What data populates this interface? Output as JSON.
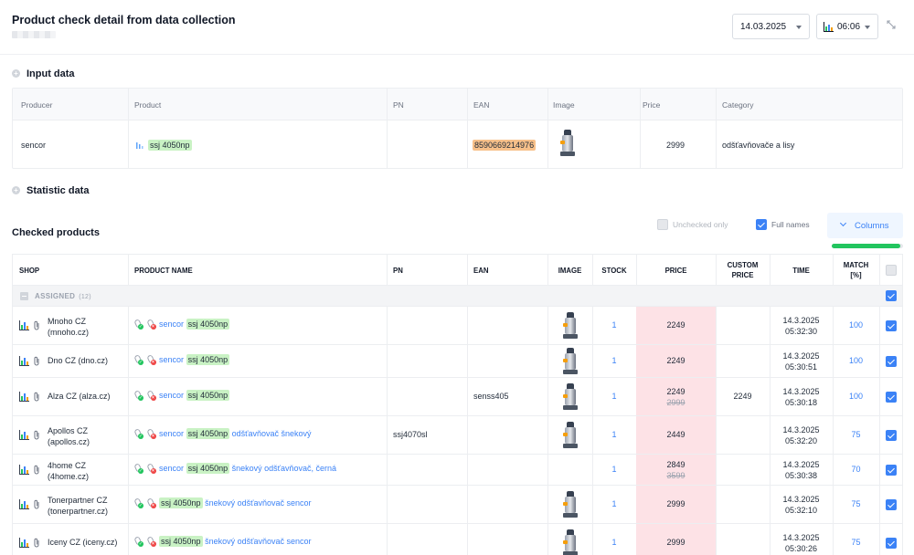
{
  "header": {
    "title": "Product check detail from data collection",
    "date": "14.03.2025",
    "time": "06:06"
  },
  "input_data": {
    "title": "Input data",
    "columns": [
      "Producer",
      "Product",
      "PN",
      "EAN",
      "Image",
      "Price",
      "Category"
    ],
    "row": {
      "producer": "sencor",
      "product": "ssj 4050np",
      "pn": "",
      "ean": "8590669214976",
      "price": "2999",
      "category": "odšťavňovače a lisy"
    }
  },
  "statistic_data": {
    "title": "Statistic data"
  },
  "checked": {
    "title": "Checked products",
    "unchecked_only_label": "Unchecked only",
    "unchecked_only": false,
    "full_names_label": "Full names",
    "full_names": true,
    "columns_button": "Columns",
    "progress": 0.96,
    "headers": {
      "shop": "SHOP",
      "product_name": "PRODUCT NAME",
      "pn": "PN",
      "ean": "EAN",
      "image": "IMAGE",
      "stock": "STOCK",
      "price": "PRICE",
      "custom_price_1": "CUSTOM",
      "custom_price_2": "PRICE",
      "time": "TIME",
      "match_1": "MATCH",
      "match_2": "[%]"
    },
    "group": {
      "label": "ASSIGNED",
      "count": "(12)"
    },
    "rows": [
      {
        "shop1": "Mnoho CZ",
        "shop2": "(mnoho.cz)",
        "brand": "sencor",
        "model": "ssj 4050np",
        "suffix": "",
        "pn": "",
        "ean": "",
        "image": true,
        "stock": "1",
        "price": "2249",
        "old_price": "",
        "custom_price": "",
        "date": "14.3.2025",
        "time": "05:32:30",
        "match": "100",
        "checked": true
      },
      {
        "shop1": "Dno CZ (dno.cz)",
        "shop2": "",
        "brand": "sencor",
        "model": "ssj 4050np",
        "suffix": "",
        "pn": "",
        "ean": "",
        "image": true,
        "stock": "1",
        "price": "2249",
        "old_price": "",
        "custom_price": "",
        "date": "14.3.2025",
        "time": "05:30:51",
        "match": "100",
        "checked": true
      },
      {
        "shop1": "Alza CZ (alza.cz)",
        "shop2": "",
        "brand": "sencor",
        "model": "ssj 4050np",
        "suffix": "",
        "pn": "",
        "ean": "senss405",
        "image": true,
        "stock": "1",
        "price": "2249",
        "old_price": "2999",
        "custom_price": "2249",
        "date": "14.3.2025",
        "time": "05:30:18",
        "match": "100",
        "checked": true
      },
      {
        "shop1": "Apollos CZ",
        "shop2": "(apollos.cz)",
        "brand": "sencor",
        "model": "ssj 4050np",
        "suffix": "odšťavňovač šnekový",
        "pn": "ssj4070sl",
        "ean": "",
        "image": true,
        "stock": "1",
        "price": "2449",
        "old_price": "",
        "custom_price": "",
        "date": "14.3.2025",
        "time": "05:32:20",
        "match": "75",
        "checked": true
      },
      {
        "shop1": "4home CZ",
        "shop2": "(4home.cz)",
        "brand": "sencor",
        "model": "ssj 4050np",
        "suffix": "šnekový odšťavňovač, černá",
        "pn": "",
        "ean": "",
        "image": false,
        "stock": "1",
        "price": "2849",
        "old_price": "3599",
        "custom_price": "",
        "date": "14.3.2025",
        "time": "05:30:38",
        "match": "70",
        "checked": true
      },
      {
        "shop1": "Tonerpartner CZ",
        "shop2": "(tonerpartner.cz)",
        "brand": "",
        "model": "ssj 4050np",
        "suffix": "šnekový odšťavňovač sencor",
        "pn": "",
        "ean": "",
        "image": true,
        "stock": "1",
        "price": "2999",
        "old_price": "",
        "custom_price": "",
        "date": "14.3.2025",
        "time": "05:32:10",
        "match": "75",
        "checked": true
      },
      {
        "shop1": "Iceny CZ (iceny.cz)",
        "shop2": "",
        "brand": "",
        "model": "ssj 4050np",
        "suffix": "šnekový odšťavňovač sencor",
        "pn": "",
        "ean": "",
        "image": true,
        "stock": "1",
        "price": "2999",
        "old_price": "",
        "custom_price": "",
        "date": "14.3.2025",
        "time": "05:30:26",
        "match": "75",
        "checked": true
      }
    ]
  }
}
